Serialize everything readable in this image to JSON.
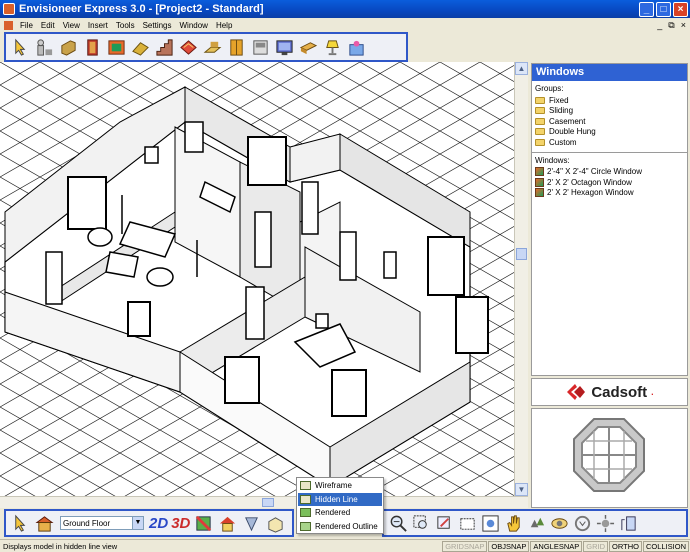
{
  "window": {
    "title": "Envisioneer Express 3.0 - [Project2 - Standard]"
  },
  "menu": {
    "items": [
      "File",
      "Edit",
      "View",
      "Insert",
      "Tools",
      "Settings",
      "Window",
      "Help"
    ],
    "mdi_controls": [
      "_",
      " ̷",
      "x"
    ]
  },
  "toolbar_top": {
    "icons": [
      "select-arrow-icon",
      "dimension-icon",
      "wall-icon",
      "door-icon",
      "window-icon",
      "roof-icon",
      "stair-icon",
      "deck-icon",
      "floor-icon",
      "cabinet-icon",
      "appliance-icon",
      "tv-icon",
      "furniture-icon",
      "lighting-icon",
      "decor-icon"
    ]
  },
  "panel": {
    "title": "Windows",
    "groups_label": "Groups:",
    "groups": [
      "Fixed",
      "Sliding",
      "Casement",
      "Double Hung",
      "Custom"
    ],
    "windows_label": "Windows:",
    "windows": [
      "2'-4\" X 2'-4\" Circle Window",
      "2' X 2' Octagon Window",
      "2' X 2' Hexagon Window"
    ],
    "brand": "Cadsoft",
    "brand_suffix": "."
  },
  "toolbar_bottom": {
    "floor_value": "Ground Floor",
    "btn_2d": "2D",
    "btn_3d": "3D"
  },
  "view_menu": {
    "items": [
      {
        "label": "Wireframe",
        "selected": false
      },
      {
        "label": "Hidden Line",
        "selected": true
      },
      {
        "label": "Rendered",
        "selected": false
      },
      {
        "label": "Rendered Outline",
        "selected": false
      }
    ]
  },
  "status": {
    "text": "Displays model in hidden line view",
    "indicators": [
      {
        "label": "GRIDSNAP",
        "active": false
      },
      {
        "label": "OBJSNAP",
        "active": true
      },
      {
        "label": "ANGLESNAP",
        "active": true
      },
      {
        "label": "GRID",
        "active": false
      },
      {
        "label": "ORTHO",
        "active": true
      },
      {
        "label": "COLLISION",
        "active": true
      }
    ]
  },
  "colors": {
    "title_blue": "#0a5ddc",
    "panel_blue": "#2f62d3",
    "selection": "#316ac5",
    "toolbar_border": "#2f57c8"
  }
}
